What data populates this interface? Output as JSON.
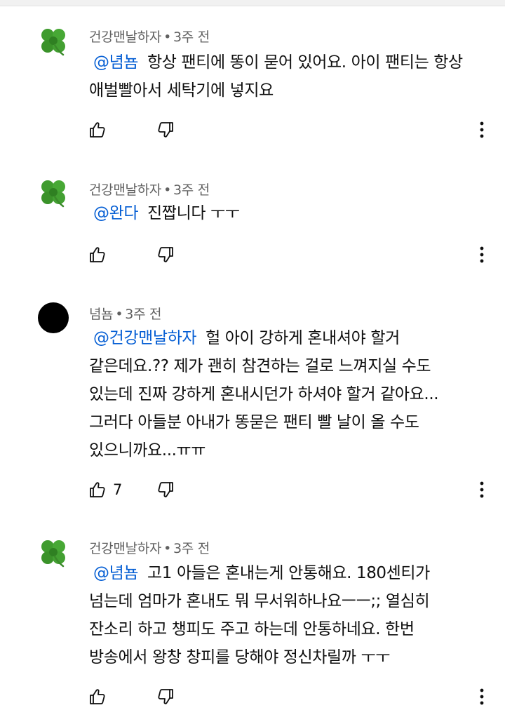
{
  "comments": [
    {
      "avatar": "clover-avatar",
      "author": "건강맨날하자",
      "time": "3주 전",
      "mention": "@념뇸",
      "lines": [
        "항상 팬티에 똥이 묻어 있어요. 아이 팬티는 항상",
        "애벌빨아서 세탁기에 넣지요"
      ],
      "likes": ""
    },
    {
      "avatar": "clover-avatar",
      "author": "건강맨날하자",
      "time": "3주 전",
      "mention": "@완다",
      "lines": [
        "진짭니다 ㅜㅜ"
      ],
      "likes": ""
    },
    {
      "avatar": "black-circle-avatar",
      "author": "념뇸",
      "time": "3주 전",
      "mention": "@건강맨날하자",
      "lines": [
        "헐 아이 강하게 혼내셔야 할거",
        "같은데요.?? 제가 괜히 참견하는 걸로 느껴지실 수도",
        "있는데 진짜 강하게 혼내시던가 하셔야 할거 같아요...",
        "그러다 아들분 아내가 똥묻은 팬티 빨 날이 올 수도",
        "있으니까요...ㅠㅠ"
      ],
      "likes": "7"
    },
    {
      "avatar": "clover-avatar",
      "author": "건강맨날하자",
      "time": "3주 전",
      "mention": "@념뇸",
      "lines": [
        "고1 아들은 혼내는게 안통해요. 180센티가",
        "넘는데 엄마가 혼내도 뭐 무서워하나요ㅡㅡ;; 열심히",
        "잔소리 하고 챙피도 주고 하는데 안통하네요. 한번",
        "방송에서 왕창 창피를 당해야 정신차릴까 ㅜㅜ"
      ],
      "likes": ""
    }
  ],
  "colors": {
    "mention": "#065fd4",
    "meta": "#606060",
    "text": "#0f0f0f",
    "clover": "#3f9b2e"
  },
  "icons": {
    "like": "thumbs-up-icon",
    "dislike": "thumbs-down-icon",
    "more": "more-vert-icon"
  }
}
